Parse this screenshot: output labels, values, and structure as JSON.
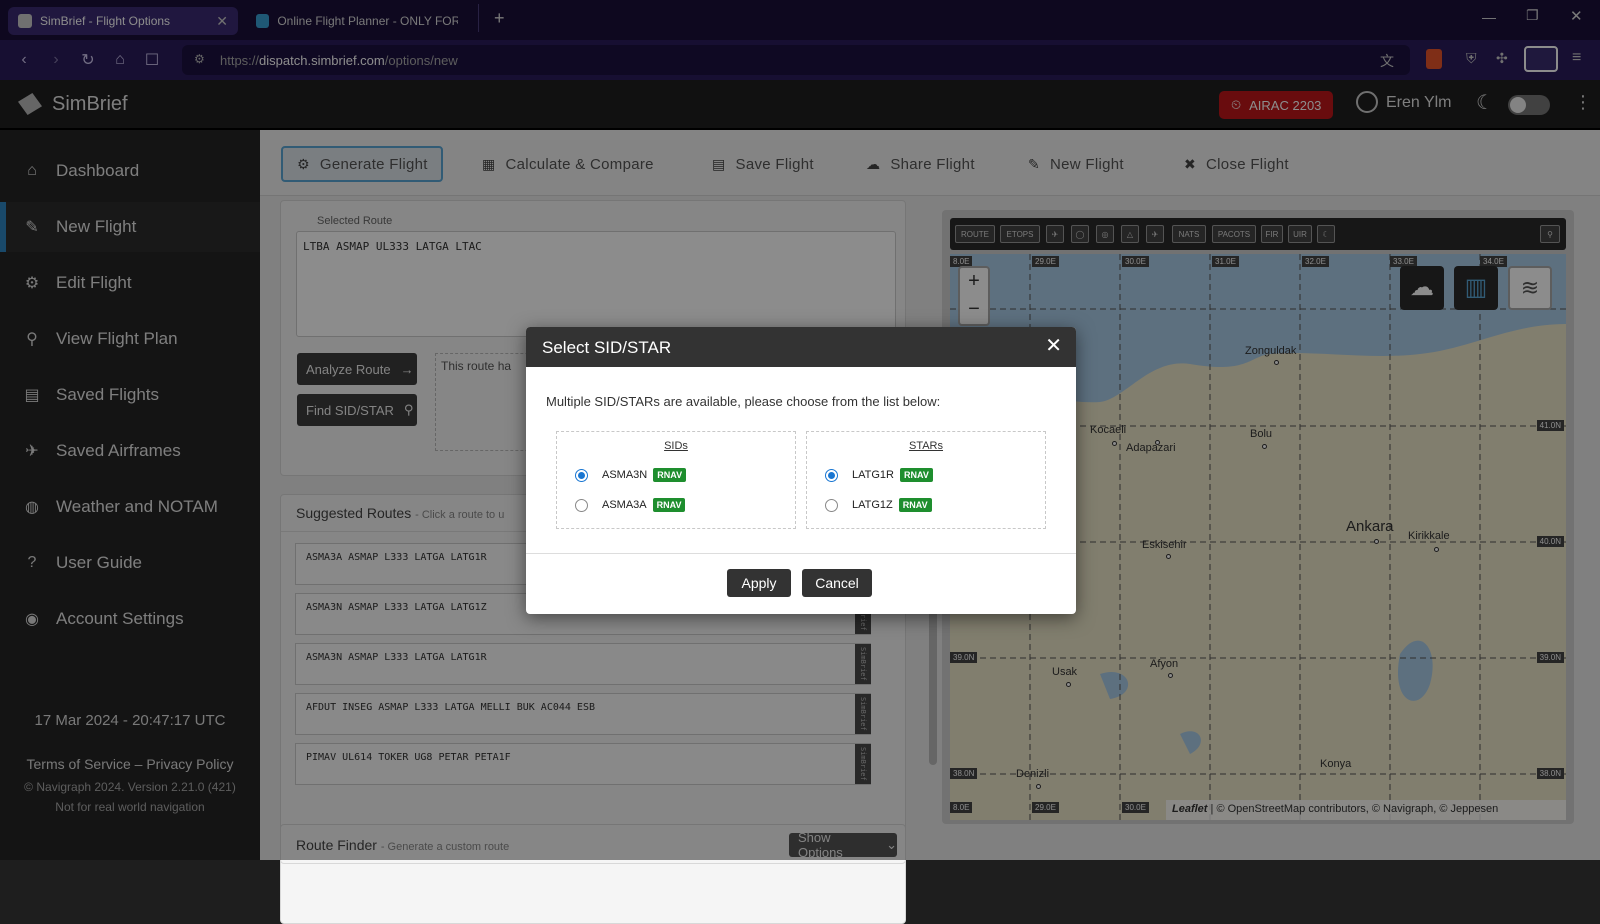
{
  "browser": {
    "tabs": [
      {
        "title": "SimBrief - Flight Options",
        "active": true
      },
      {
        "title": "Online Flight Planner - ONLY FOR FL",
        "active": false
      }
    ],
    "url_prefix": "https://",
    "url_domain": "dispatch.simbrief.com",
    "url_path": "/options/new"
  },
  "app": {
    "brand": "SimBrief",
    "airac": "AIRAC 2203",
    "user": "Eren Ylm",
    "accent": "#2e86c1"
  },
  "sidebar": {
    "items": [
      {
        "label": "Dashboard",
        "icon": "home-icon"
      },
      {
        "label": "New Flight",
        "icon": "pencil-icon",
        "active": true
      },
      {
        "label": "Edit Flight",
        "icon": "gear-icon"
      },
      {
        "label": "View Flight Plan",
        "icon": "search-icon"
      },
      {
        "label": "Saved Flights",
        "icon": "save-icon"
      },
      {
        "label": "Saved Airframes",
        "icon": "plane-icon"
      },
      {
        "label": "Weather and NOTAM",
        "icon": "globe-icon"
      },
      {
        "label": "User Guide",
        "icon": "question-icon"
      },
      {
        "label": "Account Settings",
        "icon": "user-icon"
      }
    ],
    "clock": "17 Mar 2024 - 20:47:17 UTC",
    "terms": "Terms of Service",
    "sep": "–",
    "privacy": "Privacy Policy",
    "copyright": "© Navigraph 2024. Version 2.21.0 (421)",
    "disclaimer": "Not for real world navigation"
  },
  "toolbar": {
    "generate": "Generate Flight",
    "calculate": "Calculate & Compare",
    "save": "Save Flight",
    "share": "Share Flight",
    "new": "New Flight",
    "close": "Close Flight"
  },
  "route_panel": {
    "label": "Selected Route",
    "value": "LTBA ASMAP UL333 LATGA LTAC",
    "analyze": "Analyze Route",
    "find_sidstar": "Find SID/STAR",
    "info_text": "This route ha"
  },
  "suggested": {
    "title": "Suggested Routes",
    "hint": "- Click a route to u",
    "tag": "SimBrief",
    "routes": [
      "ASMA3A ASMAP L333 LATGA LATG1R",
      "ASMA3N ASMAP L333 LATGA LATG1Z",
      "ASMA3N ASMAP L333 LATGA LATG1R",
      "AFDUT INSEG ASMAP L333 LATGA MELLI BUK AC044 ESB",
      "PIMAV UL614 TOKER UG8 PETAR PETA1F"
    ]
  },
  "route_finder": {
    "title": "Route Finder",
    "hint": "- Generate a custom route",
    "show_options": "Show Options"
  },
  "map": {
    "tools": [
      "ROUTE",
      "ETOPS",
      "NATS",
      "PACOTS",
      "FIR",
      "UIR"
    ],
    "zoom_in": "+",
    "zoom_out": "−",
    "lon_labels": [
      "8.0E",
      "29.0E",
      "30.0E",
      "31.0E",
      "32.0E",
      "33.0E",
      "34.0E"
    ],
    "lat_labels": [
      "41.0N",
      "40.0N",
      "39.0N",
      "38.0N"
    ],
    "bottom_lon": [
      "8.0E",
      "29.0E",
      "30.0E"
    ],
    "cities": [
      "Zonguldak",
      "Kocaeli",
      "Adapazari",
      "Bolu",
      "Ankara",
      "Kirikkale",
      "Eskisehir",
      "Usak",
      "Afyon",
      "Denizli",
      "Konya"
    ],
    "attribution_leaflet": "Leaflet",
    "attribution": "| © OpenStreetMap contributors, © Navigraph, © Jeppesen"
  },
  "modal": {
    "title": "Select SID/STAR",
    "message": "Multiple SID/STARs are available, please choose from the list below:",
    "sids_label": "SIDs",
    "stars_label": "STARs",
    "sids": [
      {
        "name": "ASMA3N",
        "tag": "RNAV",
        "selected": true
      },
      {
        "name": "ASMA3A",
        "tag": "RNAV",
        "selected": false
      }
    ],
    "stars": [
      {
        "name": "LATG1R",
        "tag": "RNAV",
        "selected": true
      },
      {
        "name": "LATG1Z",
        "tag": "RNAV",
        "selected": false
      }
    ],
    "apply": "Apply",
    "cancel": "Cancel"
  }
}
